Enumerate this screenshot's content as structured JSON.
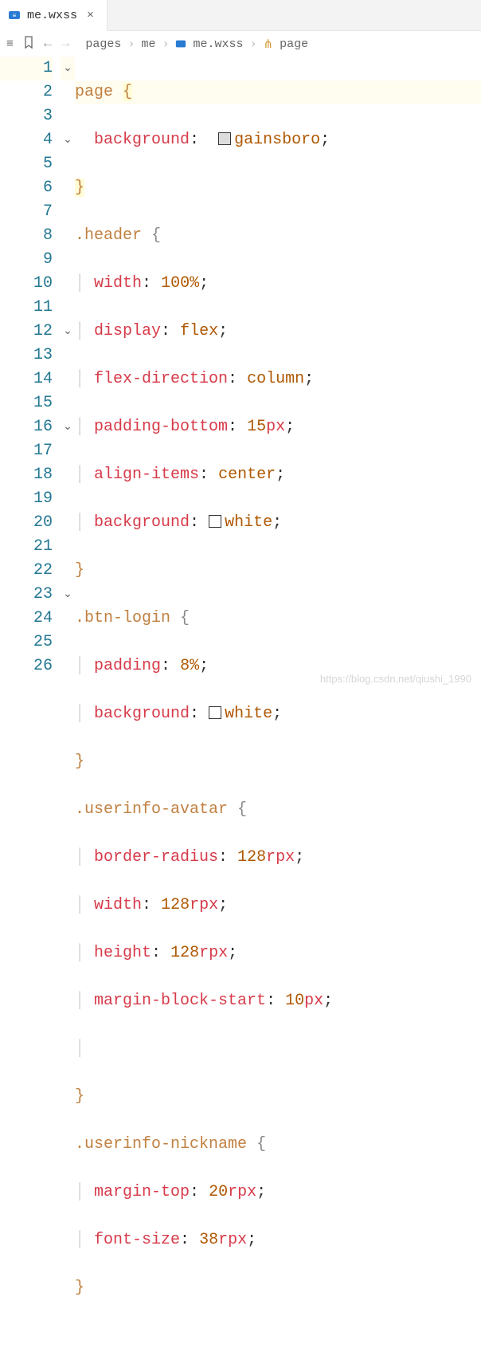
{
  "tab": {
    "label": "me.wxss",
    "close": "×"
  },
  "toolbar": {
    "breadcrumbs": [
      "pages",
      "me",
      "me.wxss",
      "page"
    ]
  },
  "gutter": {
    "lines": [
      "1",
      "2",
      "3",
      "4",
      "5",
      "6",
      "7",
      "8",
      "9",
      "10",
      "11",
      "12",
      "13",
      "14",
      "15",
      "16",
      "17",
      "18",
      "19",
      "20",
      "21",
      "22",
      "23",
      "24",
      "25",
      "26"
    ]
  },
  "folds": {
    "l1": "⌄",
    "l4": "⌄",
    "l12": "⌄",
    "l16": "⌄",
    "l23": "⌄"
  },
  "code": {
    "page_sel": "page",
    "open": "{",
    "close": "}",
    "background": "background",
    "colon": ":",
    "semi": ";",
    "gainsboro": "gainsboro",
    "header_sel": ".header",
    "width": "width",
    "w100": "100%",
    "display": "display",
    "flex": "flex",
    "flexdir": "flex-direction",
    "column": "column",
    "padbot": "padding-bottom",
    "v15": "15",
    "px": "px",
    "alignitems": "align-items",
    "center": "center",
    "white": "white",
    "btn_sel": ".btn-login",
    "padding": "padding",
    "v8p": "8%",
    "avatar_sel": ".userinfo-avatar",
    "bradius": "border-radius",
    "v128": "128",
    "rpx": "rpx",
    "height": "height",
    "mbs": "margin-block-start",
    "v10": "10",
    "nick_sel": ".userinfo-nickname",
    "mtop": "margin-top",
    "v20": "20",
    "fsize": "font-size",
    "v38": "38"
  },
  "watermark": "https://blog.csdn.net/qiushi_1990"
}
